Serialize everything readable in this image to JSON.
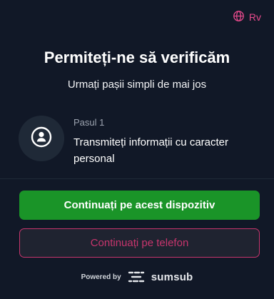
{
  "header": {
    "language_code": "Rv",
    "language_icon": "globe-icon"
  },
  "main": {
    "title": "Permiteți-ne să verificăm",
    "subtitle": "Urmați pașii simpli de mai jos"
  },
  "step": {
    "icon": "user-circle-icon",
    "label": "Pasul 1",
    "description": "Transmiteți informații cu caracter personal"
  },
  "actions": {
    "primary_label": "Continuați pe acest dispozitiv",
    "secondary_label": "Continuați pe telefon"
  },
  "footer": {
    "powered_by": "Powered by",
    "brand": "sumsub"
  },
  "colors": {
    "background": "#111827",
    "accent_pink": "#c7356d",
    "primary_green": "#1a9428"
  }
}
